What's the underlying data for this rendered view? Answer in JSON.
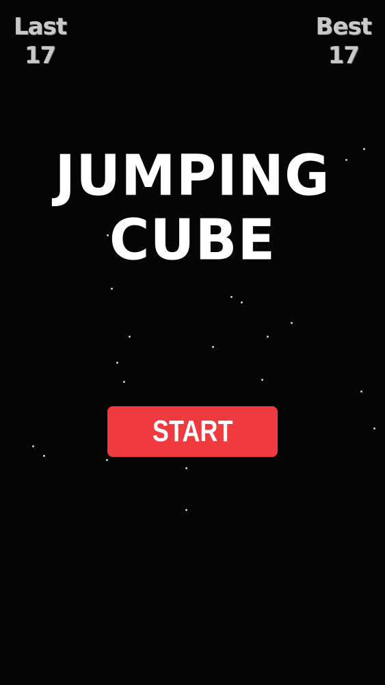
{
  "scores": {
    "last_label": "Last",
    "last_value": "17",
    "best_label": "Best",
    "best_value": "17"
  },
  "title": {
    "line1": "JUMPING",
    "line2": "CUBE"
  },
  "start_button": {
    "label": "START",
    "color": "#ef3a3f"
  },
  "background_color": "#050505"
}
